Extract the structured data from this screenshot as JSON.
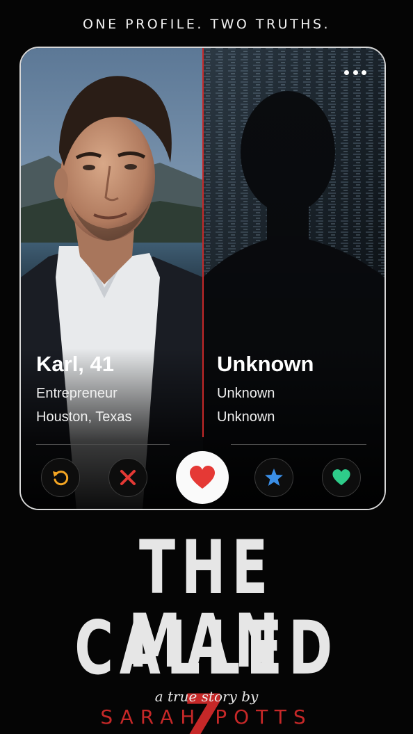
{
  "tagline": "ONE PROFILE. TWO TRUTHS.",
  "left_profile": {
    "name": "Karl, 41",
    "occupation": "Entrepreneur",
    "location": "Houston, Texas"
  },
  "right_profile": {
    "name": "Unknown",
    "occupation": "Unknown",
    "location": "Unknown"
  },
  "menu_icon": "more-dots-icon",
  "actions": [
    {
      "name": "rewind",
      "icon": "rewind-icon",
      "color": "#f5a623"
    },
    {
      "name": "nope",
      "icon": "x-icon",
      "color": "#e53935"
    },
    {
      "name": "like",
      "icon": "heart-icon",
      "color": "#e53935"
    },
    {
      "name": "super-like",
      "icon": "star-icon",
      "color": "#3a8ee6"
    },
    {
      "name": "match",
      "icon": "heart-icon",
      "color": "#2ecc8a"
    }
  ],
  "book": {
    "title_line1": "THE MAN",
    "title_line2": "CALLED ",
    "title_accent": "Z",
    "byline": "a true story by",
    "author": "SARAH POTTS"
  },
  "colors": {
    "accent": "#c62828",
    "background": "#050505"
  }
}
